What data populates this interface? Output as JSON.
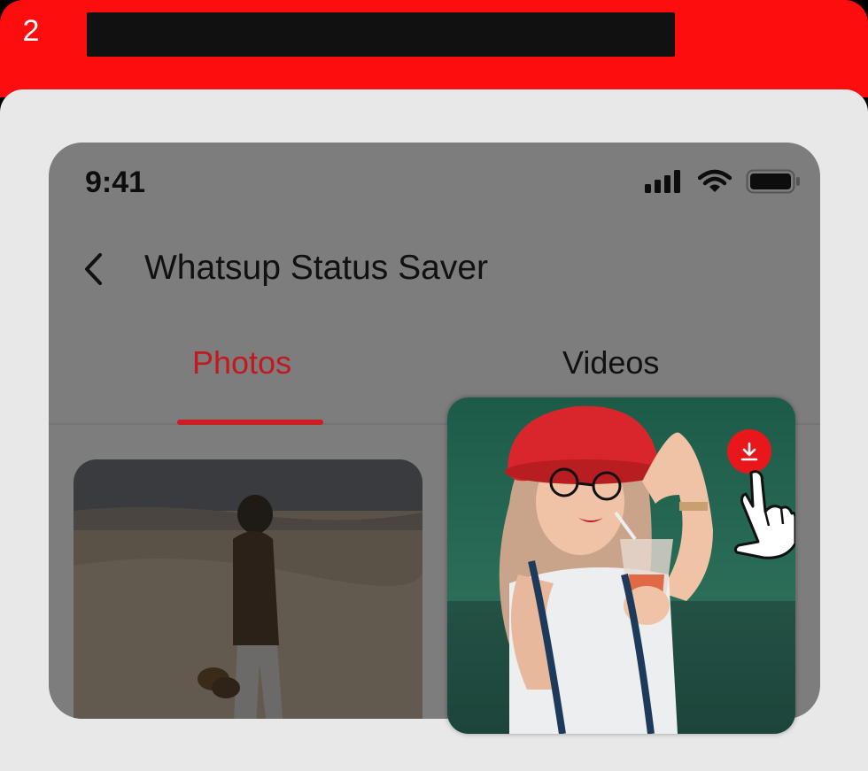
{
  "step": {
    "number": "2",
    "title": ""
  },
  "status_bar": {
    "time": "9:41",
    "icons": [
      "signal-icon",
      "wifi-icon",
      "battery-icon"
    ]
  },
  "nav": {
    "back_icon": "chevron-left-icon",
    "title": "Whatsup Status Saver"
  },
  "tabs": [
    {
      "label": "Photos",
      "active": true
    },
    {
      "label": "Videos",
      "active": false
    }
  ],
  "items": [
    {
      "kind": "photo",
      "description_icon": "photo-thumbnail"
    },
    {
      "kind": "photo",
      "description_icon": "photo-thumbnail",
      "action_icon": "download-icon"
    }
  ],
  "colors": {
    "accent": "#fe0d0f",
    "active_tab": "#c2181f",
    "download_button": "#e9171c"
  }
}
